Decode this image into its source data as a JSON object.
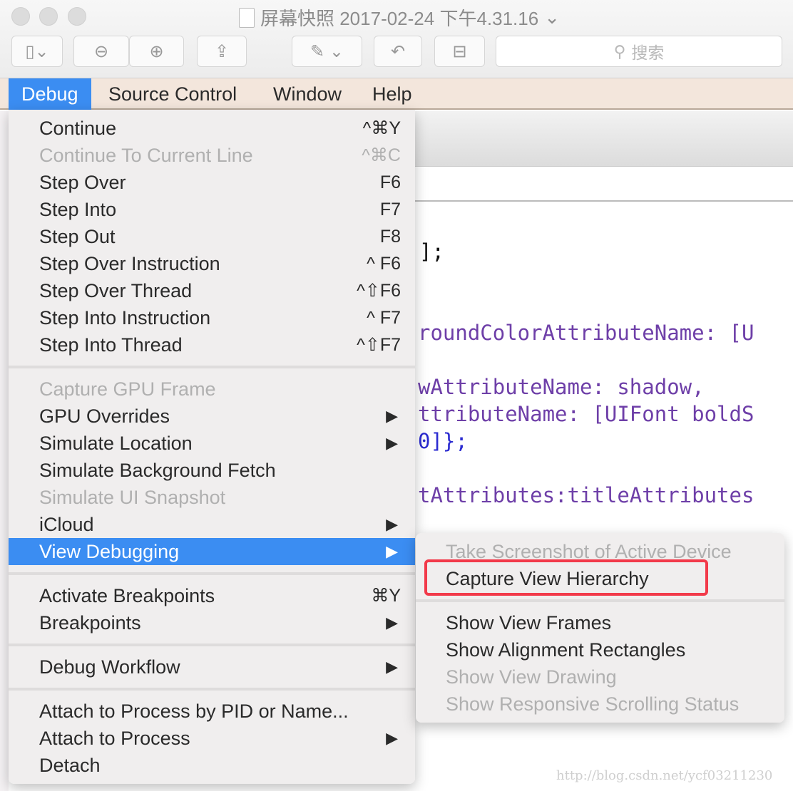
{
  "window": {
    "title": "屏幕快照 2017-02-24 下午4.31.16",
    "search_placeholder": "搜索"
  },
  "toolbar": {
    "buttons": [
      "sidebar-icon",
      "zoom-out-icon",
      "zoom-in-icon",
      "share-icon",
      "markup-icon",
      "rotate-icon",
      "toolbox-icon"
    ]
  },
  "menubar": {
    "items": [
      "Debug",
      "Source Control",
      "Window",
      "Help"
    ],
    "active": "Debug"
  },
  "debug_menu": {
    "items": [
      {
        "label": "Continue",
        "shortcut": "^⌘Y"
      },
      {
        "label": "Continue To Current Line",
        "shortcut": "^⌘C",
        "disabled": true
      },
      {
        "label": "Step Over",
        "shortcut": "F6"
      },
      {
        "label": "Step Into",
        "shortcut": "F7"
      },
      {
        "label": "Step Out",
        "shortcut": "F8"
      },
      {
        "label": "Step Over Instruction",
        "shortcut": "^ F6"
      },
      {
        "label": "Step Over Thread",
        "shortcut": "^⇧F6"
      },
      {
        "label": "Step Into Instruction",
        "shortcut": "^ F7"
      },
      {
        "label": "Step Into Thread",
        "shortcut": "^⇧F7"
      },
      {
        "separator": true
      },
      {
        "label": "Capture GPU Frame",
        "disabled": true
      },
      {
        "label": "GPU Overrides",
        "submenu": true
      },
      {
        "label": "Simulate Location",
        "submenu": true
      },
      {
        "label": "Simulate Background Fetch"
      },
      {
        "label": "Simulate UI Snapshot",
        "disabled": true
      },
      {
        "label": "iCloud",
        "submenu": true
      },
      {
        "label": "View Debugging",
        "submenu": true,
        "highlighted": true
      },
      {
        "separator": true
      },
      {
        "label": "Activate Breakpoints",
        "shortcut": "⌘Y"
      },
      {
        "label": "Breakpoints",
        "submenu": true
      },
      {
        "separator": true
      },
      {
        "label": "Debug Workflow",
        "submenu": true
      },
      {
        "separator": true
      },
      {
        "label": "Attach to Process by PID or Name..."
      },
      {
        "label": "Attach to Process",
        "submenu": true
      },
      {
        "label": "Detach"
      }
    ]
  },
  "view_debugging_submenu": {
    "items": [
      {
        "label": "Take Screenshot of Active Device",
        "disabled": true
      },
      {
        "label": "Capture View Hierarchy",
        "annotated": true
      },
      {
        "separator": true
      },
      {
        "label": "Show View Frames"
      },
      {
        "label": "Show Alignment Rectangles"
      },
      {
        "label": "Show View Drawing",
        "disabled": true
      },
      {
        "label": "Show Responsive Scrolling Status",
        "disabled": true
      }
    ]
  },
  "code": {
    "lines": [
      "];",
      "roundColorAttributeName: [U",
      "wAttributeName: shadow,",
      "ttributeName: [UIFont boldS",
      "0]};",
      "tAttributes:titleAttributes"
    ]
  },
  "watermark": "http://blog.csdn.net/ycf03211230",
  "colors": {
    "highlight": "#3b8df2",
    "annotation": "#f23a4a",
    "menubar": "#f3e6dc"
  }
}
